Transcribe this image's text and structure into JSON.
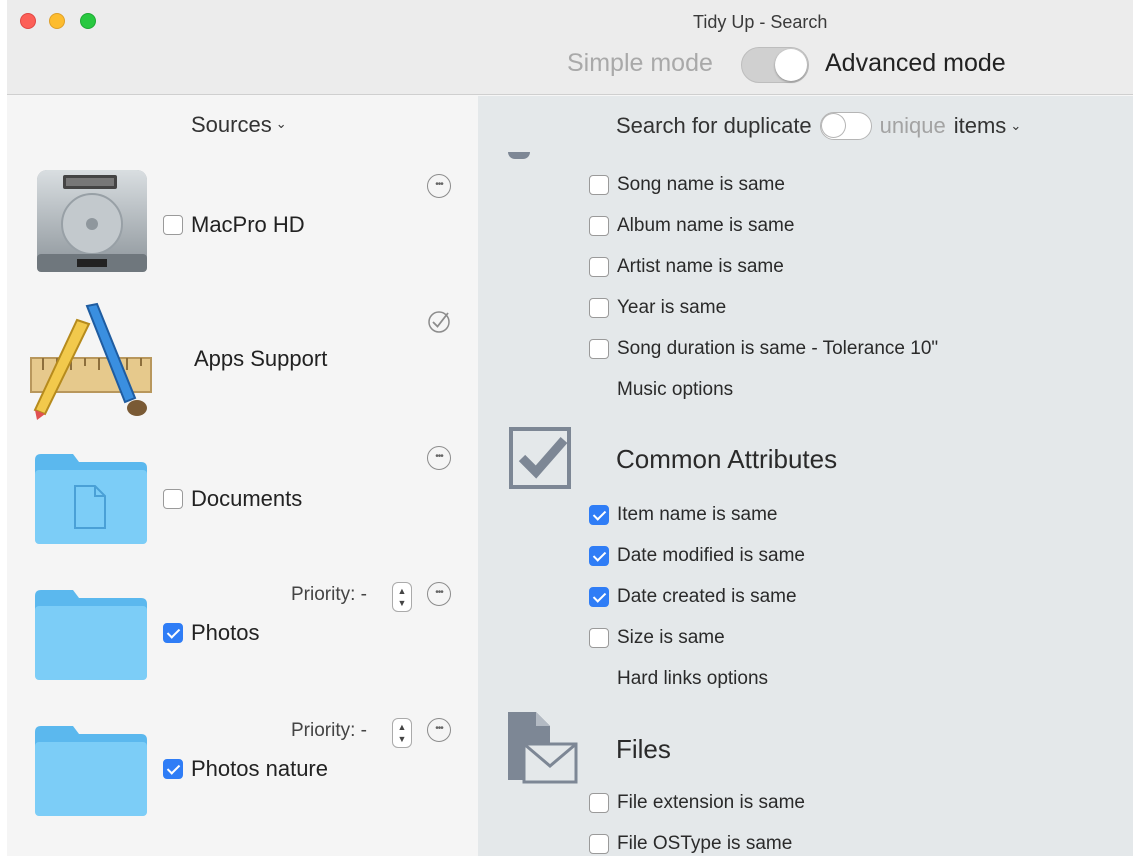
{
  "window": {
    "title": "Tidy Up - Search"
  },
  "mode": {
    "simple_label": "Simple mode",
    "advanced_label": "Advanced mode",
    "advanced_on": true
  },
  "sources": {
    "header": "Sources",
    "items": [
      {
        "label": "MacPro HD",
        "checked": false,
        "icon": "hard-drive-icon",
        "action": "more"
      },
      {
        "label": "Apps Support",
        "icon": "applications-icon",
        "action": "check"
      },
      {
        "label": "Documents",
        "checked": false,
        "icon": "documents-folder-icon",
        "action": "more"
      },
      {
        "label": "Photos",
        "checked": true,
        "icon": "folder-icon",
        "action": "more",
        "priority_label": "Priority: -"
      },
      {
        "label": "Photos nature",
        "checked": true,
        "icon": "folder-icon",
        "action": "more",
        "priority_label": "Priority: -"
      }
    ]
  },
  "search": {
    "prefix": "Search for duplicate",
    "unique_label": "unique",
    "suffix": "items",
    "unique_on": false
  },
  "music": {
    "options": [
      {
        "label": "Song name is same",
        "checked": false
      },
      {
        "label": "Album name is same",
        "checked": false
      },
      {
        "label": "Artist name is same",
        "checked": false
      },
      {
        "label": "Year is same",
        "checked": false
      },
      {
        "label": "Song duration is same - Tolerance 10\"",
        "checked": false
      }
    ],
    "extra_label": "Music options"
  },
  "common": {
    "title": "Common Attributes",
    "icon": "checkmark-box-icon",
    "options": [
      {
        "label": "Item name is same",
        "checked": true
      },
      {
        "label": "Date modified is same",
        "checked": true
      },
      {
        "label": "Date created is same",
        "checked": true
      },
      {
        "label": "Size is same",
        "checked": false
      }
    ],
    "extra_label": "Hard links options"
  },
  "files": {
    "title": "Files",
    "icon": "file-envelope-icon",
    "options": [
      {
        "label": "File extension is same",
        "checked": false
      },
      {
        "label": "File OSType is same",
        "checked": false
      }
    ]
  },
  "colors": {
    "accent": "#2f7df6",
    "right_pane_bg": "#e4e8ea",
    "folder": "#6cc3f4"
  }
}
